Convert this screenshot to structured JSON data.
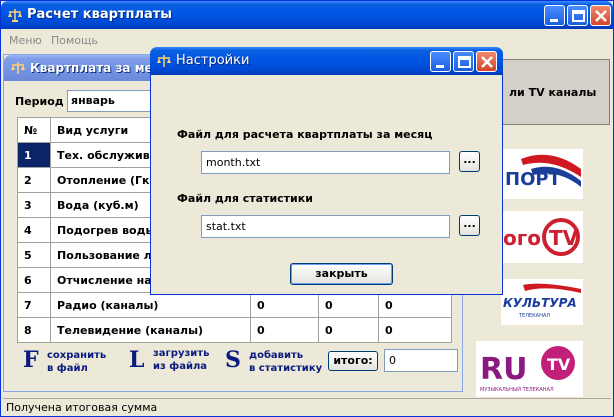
{
  "app": {
    "title": "Расчет квартплаты"
  },
  "menu": {
    "items": [
      "Меню",
      "Помощь"
    ]
  },
  "child": {
    "title": "Квартплата за месяц",
    "period_label": "Период",
    "period_value": "январь",
    "table": {
      "headers": [
        "№",
        "Вид услуги"
      ],
      "rows": [
        {
          "num": "1",
          "service": "Тех. обслуживан",
          "c1": "",
          "c2": "",
          "c3": ""
        },
        {
          "num": "2",
          "service": "Отопление (Гкал",
          "c1": "",
          "c2": "",
          "c3": ""
        },
        {
          "num": "3",
          "service": "Вода (куб.м)",
          "c1": "",
          "c2": "",
          "c3": ""
        },
        {
          "num": "4",
          "service": "Подогрев воды (",
          "c1": "",
          "c2": "",
          "c3": ""
        },
        {
          "num": "5",
          "service": "Пользование ли",
          "c1": "",
          "c2": "",
          "c3": ""
        },
        {
          "num": "6",
          "service": "Отчисление на ка",
          "c1": "",
          "c2": "",
          "c3": ""
        },
        {
          "num": "7",
          "service": "Радио (каналы)",
          "c1": "0",
          "c2": "0",
          "c3": "0"
        },
        {
          "num": "8",
          "service": "Телевидение (каналы)",
          "c1": "0",
          "c2": "0",
          "c3": "0"
        }
      ]
    },
    "hotkeys": [
      {
        "key": "F",
        "label1": "сохранить",
        "label2": "в файл"
      },
      {
        "key": "L",
        "label1": "загрузить",
        "label2": "из файла"
      },
      {
        "key": "S",
        "label1": "добавить",
        "label2": "в статистику"
      }
    ],
    "itogo_label": "итого:",
    "itogo_value": "0"
  },
  "right_panel": {
    "tv_button": "ли TV  каналы",
    "logos": [
      {
        "name": "sport",
        "text": "ПОРТ",
        "accent": "#1a3e9a"
      },
      {
        "name": "nogo-tv",
        "text": "ого",
        "tv": "TV",
        "accent": "#cc2030"
      },
      {
        "name": "kultura",
        "text": "КУЛЬТУРА",
        "sub": "ТЕЛЕКАНАЛ",
        "accent": "#1a3e9a"
      },
      {
        "name": "ru-tv",
        "text": "RU",
        "tv": "TV",
        "sub": "МУЗЫКАЛЬНЫЙ ТЕЛЕКАНАЛ",
        "accent": "#8a1a80"
      }
    ]
  },
  "dialog": {
    "title": "Настройки",
    "month_label": "Файл для расчета квартплаты за месяц",
    "month_value": "month.txt",
    "stat_label": "Файл для статистики",
    "stat_value": "stat.txt",
    "browse_label": "...",
    "close_label": "закрыть"
  },
  "status": {
    "text": "Получена итоговая сумма"
  },
  "colors": {
    "xp_blue": "#0054e3",
    "selection": "#0a246a",
    "hotkey_text": "#0a1a80"
  }
}
